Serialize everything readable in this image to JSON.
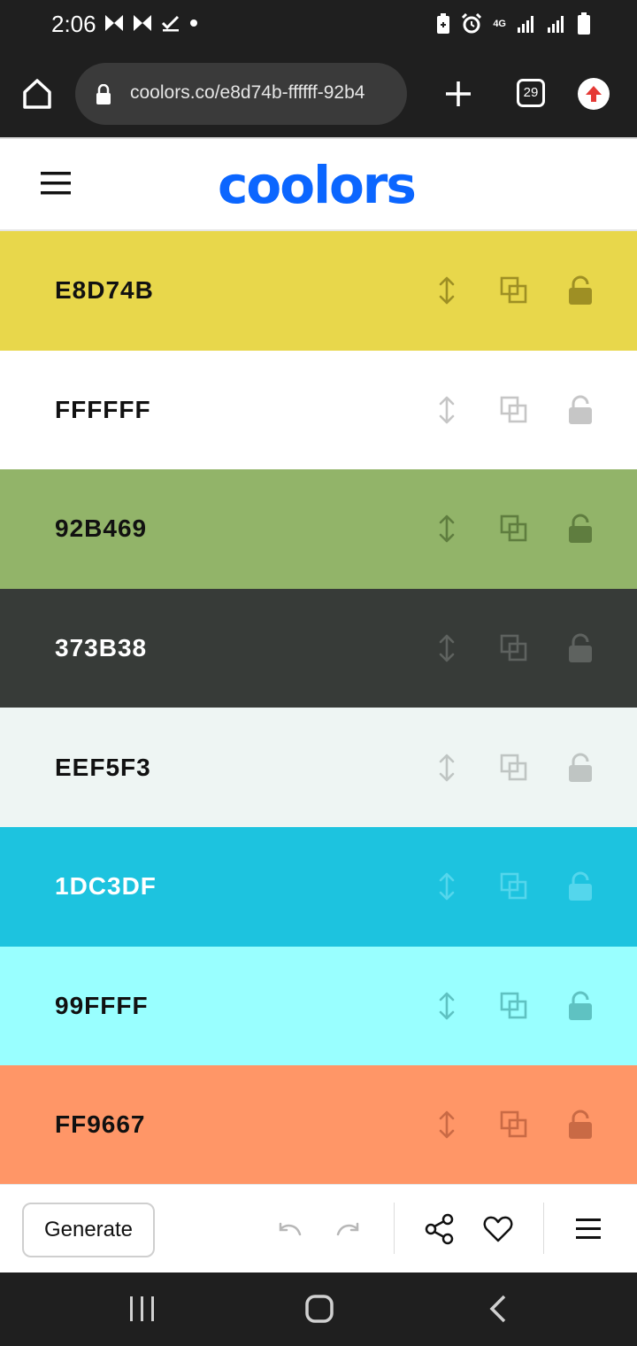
{
  "status": {
    "time": "2:06",
    "network": "4G"
  },
  "browser": {
    "url": "coolors.co/e8d74b-ffffff-92b4",
    "tab_count": "29"
  },
  "app": {
    "logo": "coolors"
  },
  "palette": [
    {
      "hex": "E8D74B",
      "bg": "#E8D74B",
      "text": "#111111",
      "icon": "#9E8F24"
    },
    {
      "hex": "FFFFFF",
      "bg": "#FFFFFF",
      "text": "#111111",
      "icon": "#C6C6C6"
    },
    {
      "hex": "92B469",
      "bg": "#92B469",
      "text": "#111111",
      "icon": "#5F7D3F"
    },
    {
      "hex": "373B38",
      "bg": "#373B38",
      "text": "#FFFFFF",
      "icon": "#5E625F"
    },
    {
      "hex": "EEF5F3",
      "bg": "#EEF5F3",
      "text": "#111111",
      "icon": "#BFC5C3"
    },
    {
      "hex": "1DC3DF",
      "bg": "#1DC3DF",
      "text": "#FFFFFF",
      "icon": "#54D6EC"
    },
    {
      "hex": "99FFFF",
      "bg": "#99FFFF",
      "text": "#111111",
      "icon": "#5FC2C2"
    },
    {
      "hex": "FF9667",
      "bg": "#FF9667",
      "text": "#111111",
      "icon": "#C96A45"
    }
  ],
  "toolbar": {
    "generate_label": "Generate"
  },
  "icons": {
    "home": "home-icon",
    "lock": "lock-icon",
    "plus": "plus-icon",
    "tabs": "tabs-icon",
    "update": "update-icon",
    "menu": "hamburger-icon",
    "drag": "drag-icon",
    "copy": "copy-icon",
    "unlock": "unlock-icon",
    "undo": "undo-icon",
    "redo": "redo-icon",
    "share": "share-icon",
    "favorite": "heart-icon",
    "more": "menu-icon",
    "recent_apps": "recent-apps-icon",
    "system_home": "system-home-icon",
    "back": "back-icon"
  }
}
